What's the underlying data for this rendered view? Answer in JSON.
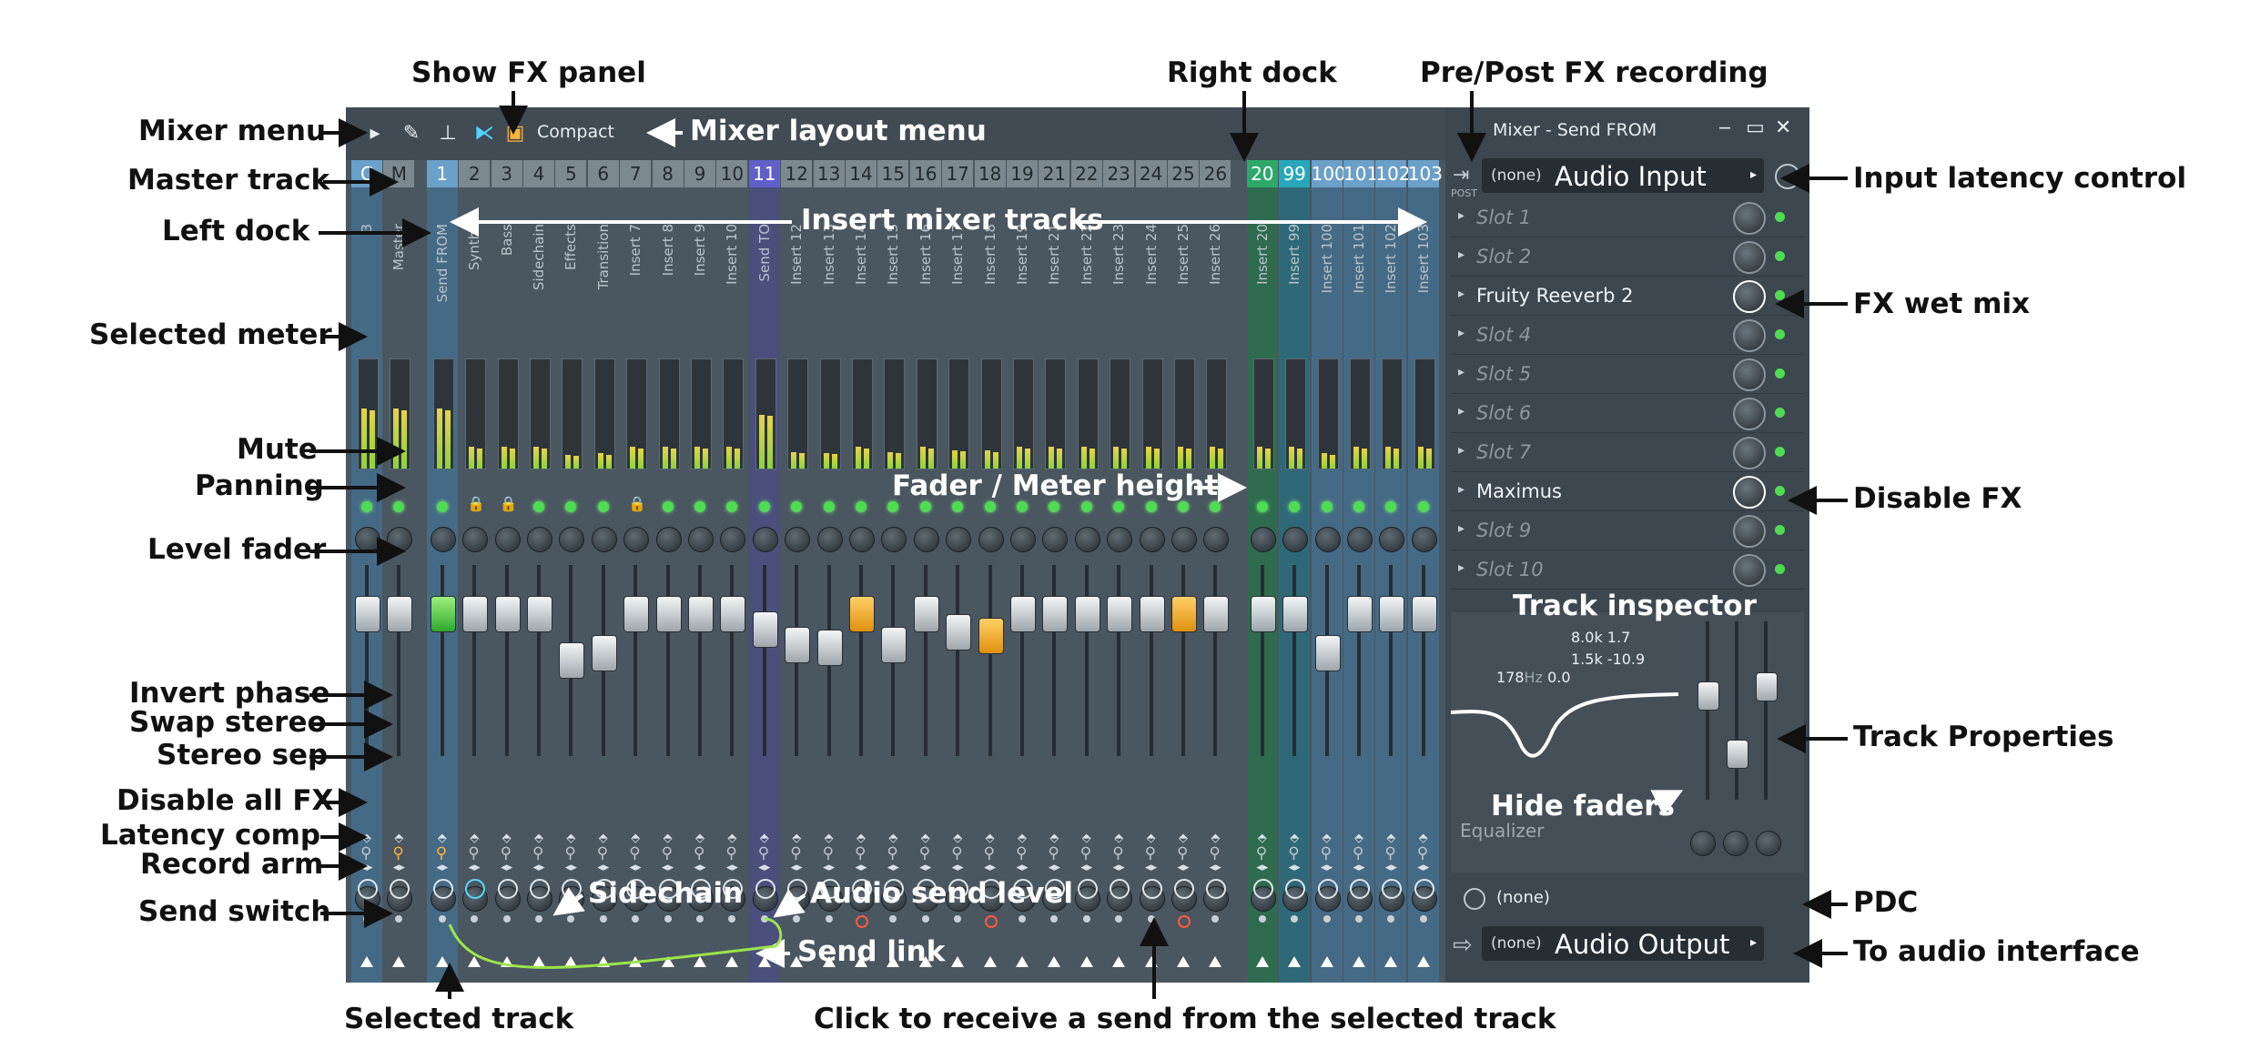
{
  "mixer": {
    "toolbar": {
      "compact_label": "Compact"
    },
    "window_title": "Mixer - Send FROM",
    "post_label": "POST",
    "tracks": [
      {
        "num": "C",
        "name": "3",
        "hl": "blue"
      },
      {
        "num": "M",
        "name": "Master",
        "hl": ""
      },
      {
        "num": "1",
        "name": "Send FROM",
        "hl": "blue"
      },
      {
        "num": "2",
        "name": "Synths",
        "hl": ""
      },
      {
        "num": "3",
        "name": "Bass",
        "hl": ""
      },
      {
        "num": "4",
        "name": "Sidechain",
        "hl": ""
      },
      {
        "num": "5",
        "name": "Effects",
        "hl": ""
      },
      {
        "num": "6",
        "name": "Transition",
        "hl": ""
      },
      {
        "num": "7",
        "name": "Insert 7",
        "hl": ""
      },
      {
        "num": "8",
        "name": "Insert 8",
        "hl": ""
      },
      {
        "num": "9",
        "name": "Insert 9",
        "hl": ""
      },
      {
        "num": "10",
        "name": "Insert 10",
        "hl": ""
      },
      {
        "num": "11",
        "name": "Send TO",
        "hl": "purple"
      },
      {
        "num": "12",
        "name": "Insert 12",
        "hl": ""
      },
      {
        "num": "13",
        "name": "Insert 13",
        "hl": ""
      },
      {
        "num": "14",
        "name": "Insert 14",
        "hl": ""
      },
      {
        "num": "15",
        "name": "Insert 15",
        "hl": ""
      },
      {
        "num": "16",
        "name": "Insert 16",
        "hl": ""
      },
      {
        "num": "17",
        "name": "Insert 17",
        "hl": ""
      },
      {
        "num": "18",
        "name": "Insert 18",
        "hl": ""
      },
      {
        "num": "19",
        "name": "Insert 19",
        "hl": ""
      },
      {
        "num": "21",
        "name": "Insert 21",
        "hl": ""
      },
      {
        "num": "22",
        "name": "Insert 22",
        "hl": ""
      },
      {
        "num": "23",
        "name": "Insert 23",
        "hl": ""
      },
      {
        "num": "24",
        "name": "Insert 24",
        "hl": ""
      },
      {
        "num": "25",
        "name": "Insert 25",
        "hl": ""
      },
      {
        "num": "26",
        "name": "Insert 26",
        "hl": ""
      },
      {
        "num": "20",
        "name": "Insert 20",
        "hl": "green"
      },
      {
        "num": "99",
        "name": "Insert 99",
        "hl": "teal"
      },
      {
        "num": "100",
        "name": "Insert 100",
        "hl": "blue"
      },
      {
        "num": "101",
        "name": "Insert 101",
        "hl": "blue"
      },
      {
        "num": "102",
        "name": "Insert 102",
        "hl": "blue"
      },
      {
        "num": "103",
        "name": "Insert 103",
        "hl": "blue"
      }
    ],
    "fader_levels": [
      0.8,
      0.8,
      0.8,
      0.8,
      0.8,
      0.8,
      0.5,
      0.55,
      0.8,
      0.8,
      0.8,
      0.8,
      0.7,
      0.6,
      0.58,
      0.8,
      0.6,
      0.8,
      0.68,
      0.66,
      0.8,
      0.8,
      0.8,
      0.8,
      0.8,
      0.8,
      0.8,
      0.8,
      0.8,
      0.55,
      0.8,
      0.8,
      0.8
    ],
    "input": {
      "none": "(none)",
      "label": "Audio Input"
    },
    "output": {
      "none": "(none)",
      "label": "Audio Output"
    },
    "slots": [
      {
        "name": "Slot 1",
        "active": false
      },
      {
        "name": "Slot 2",
        "active": false
      },
      {
        "name": "Fruity Reeverb 2",
        "active": true
      },
      {
        "name": "Slot 4",
        "active": false
      },
      {
        "name": "Slot 5",
        "active": false
      },
      {
        "name": "Slot 6",
        "active": false
      },
      {
        "name": "Slot 7",
        "active": false
      },
      {
        "name": "Maximus",
        "active": true
      },
      {
        "name": "Slot 9",
        "active": false
      },
      {
        "name": "Slot 10",
        "active": false
      }
    ],
    "eq": {
      "label": "Equalizer",
      "band_hi": "8.0k 1.7",
      "band_mid": "1.5k -10.9",
      "band_lo_freq": "178",
      "band_lo_unit": "Hz",
      "band_lo_gain": "0.0"
    },
    "pdc_none": "(none)"
  },
  "annotations": {
    "show_fx_panel": "Show FX panel",
    "right_dock": "Right dock",
    "pre_post": "Pre/Post FX recording",
    "mixer_menu": "Mixer menu",
    "mixer_layout_menu": "Mixer layout menu",
    "master_track": "Master track",
    "left_dock": "Left dock",
    "insert_mixer_tracks": "Insert mixer tracks",
    "input_latency": "Input latency control",
    "fx_wet_mix": "FX wet mix",
    "selected_meter": "Selected meter",
    "mute": "Mute",
    "panning": "Panning",
    "fader_meter_height": "Fader / Meter height",
    "disable_fx": "Disable FX",
    "level_fader": "Level fader",
    "track_inspector": "Track inspector",
    "invert_phase": "Invert phase",
    "swap_stereo": "Swap stereo",
    "stereo_sep": "Stereo sep",
    "track_properties": "Track Properties",
    "hide_faders": "Hide faders",
    "disable_all_fx": "Disable all FX",
    "latency_comp": "Latency comp",
    "record_arm": "Record arm",
    "sidechain": "Sidechain",
    "audio_send_level": "Audio send level",
    "send_switch": "Send switch",
    "pdc": "PDC",
    "send_link": "Send link",
    "to_audio_interface": "To audio interface",
    "selected_track": "Selected track",
    "click_to_receive": "Click to receive a send from the selected track"
  }
}
